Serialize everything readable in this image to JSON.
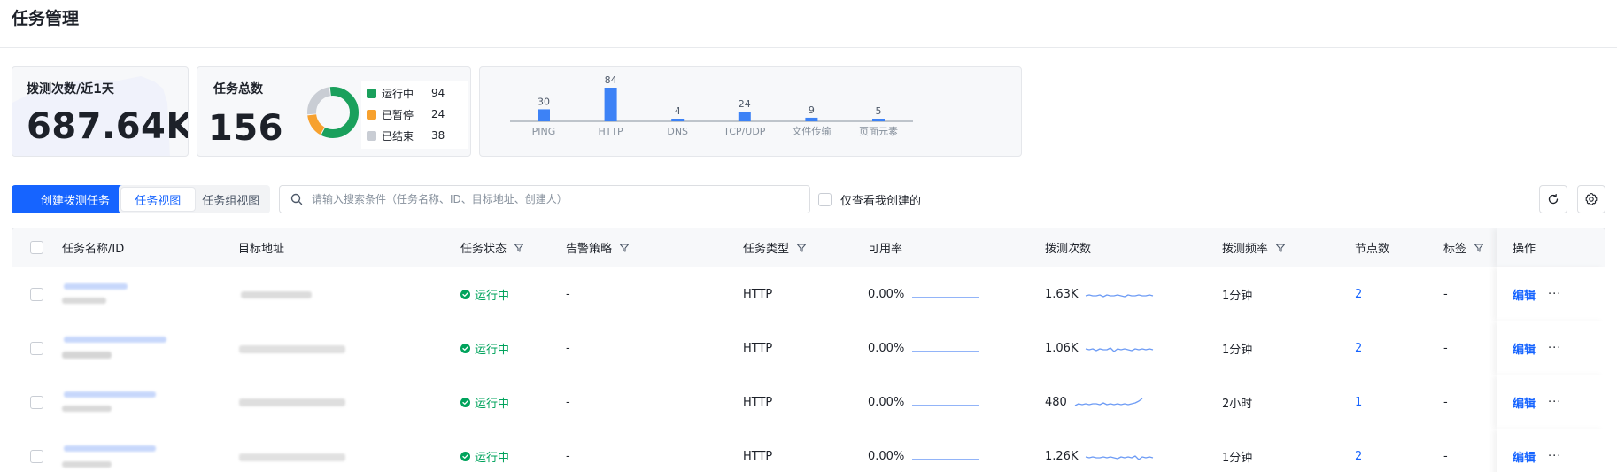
{
  "page": {
    "title": "任务管理"
  },
  "stats": {
    "probes": {
      "label": "拨测次数/近1天",
      "value": "687.64K"
    },
    "total": {
      "label": "任务总数",
      "value": "156",
      "legend": [
        {
          "label": "运行中",
          "value": 94,
          "color": "#1aa05c"
        },
        {
          "label": "已暂停",
          "value": 24,
          "color": "#f7a12e"
        },
        {
          "label": "已结束",
          "value": 38,
          "color": "#c9cdd4"
        }
      ]
    }
  },
  "chart_data": {
    "type": "bar",
    "categories": [
      "PING",
      "HTTP",
      "DNS",
      "TCP/UDP",
      "文件传输",
      "页面元素"
    ],
    "values": [
      30,
      84,
      4,
      24,
      9,
      5
    ],
    "title": "",
    "xlabel": "",
    "ylabel": "",
    "color": "#3d82f6",
    "grid": false
  },
  "toolbar": {
    "create_label": "创建拨测任务",
    "view_tabs": [
      {
        "label": "任务视图",
        "active": true
      },
      {
        "label": "任务组视图",
        "active": false
      }
    ],
    "search_placeholder": "请输入搜索条件（任务名称、ID、目标地址、创建人）",
    "mine_label": "仅查看我创建的"
  },
  "table": {
    "columns": {
      "name": "任务名称/ID",
      "target": "目标地址",
      "status": "任务状态",
      "alert": "告警策略",
      "type": "任务类型",
      "availability": "可用率",
      "count": "拨测次数",
      "frequency": "拨测频率",
      "nodes": "节点数",
      "tags": "标签",
      "ops": "操作"
    },
    "edit_label": "编辑",
    "more_label": "···",
    "rows": [
      {
        "status": "运行中",
        "alert": "-",
        "type": "HTTP",
        "availability": "0.00%",
        "count": "1.63K",
        "frequency": "1分钟",
        "nodes": "2",
        "tags": "-",
        "spark": [
          5,
          6,
          5,
          5,
          6,
          4,
          6,
          5,
          5,
          6,
          5,
          4,
          6,
          5,
          5,
          6,
          5,
          5,
          6,
          5
        ]
      },
      {
        "status": "运行中",
        "alert": "-",
        "type": "HTTP",
        "availability": "0.00%",
        "count": "1.06K",
        "frequency": "1分钟",
        "nodes": "2",
        "tags": "-",
        "spark": [
          6,
          5,
          6,
          4,
          6,
          5,
          5,
          7,
          3,
          6,
          5,
          6,
          5,
          4,
          6,
          5,
          6,
          5,
          6,
          5
        ]
      },
      {
        "status": "运行中",
        "alert": "-",
        "type": "HTTP",
        "availability": "0.00%",
        "count": "480",
        "frequency": "2小时",
        "nodes": "1",
        "tags": "-",
        "spark": [
          3,
          5,
          4,
          5,
          4,
          5,
          5,
          4,
          6,
          4,
          5,
          4,
          5,
          4,
          5,
          4,
          5,
          6,
          8,
          11
        ]
      },
      {
        "status": "运行中",
        "alert": "-",
        "type": "HTTP",
        "availability": "0.00%",
        "count": "1.26K",
        "frequency": "1分钟",
        "nodes": "2",
        "tags": "-",
        "spark": [
          6,
          5,
          6,
          5,
          5,
          6,
          5,
          6,
          5,
          4,
          6,
          5,
          6,
          5,
          7,
          3,
          6,
          5,
          6,
          5
        ]
      }
    ]
  }
}
